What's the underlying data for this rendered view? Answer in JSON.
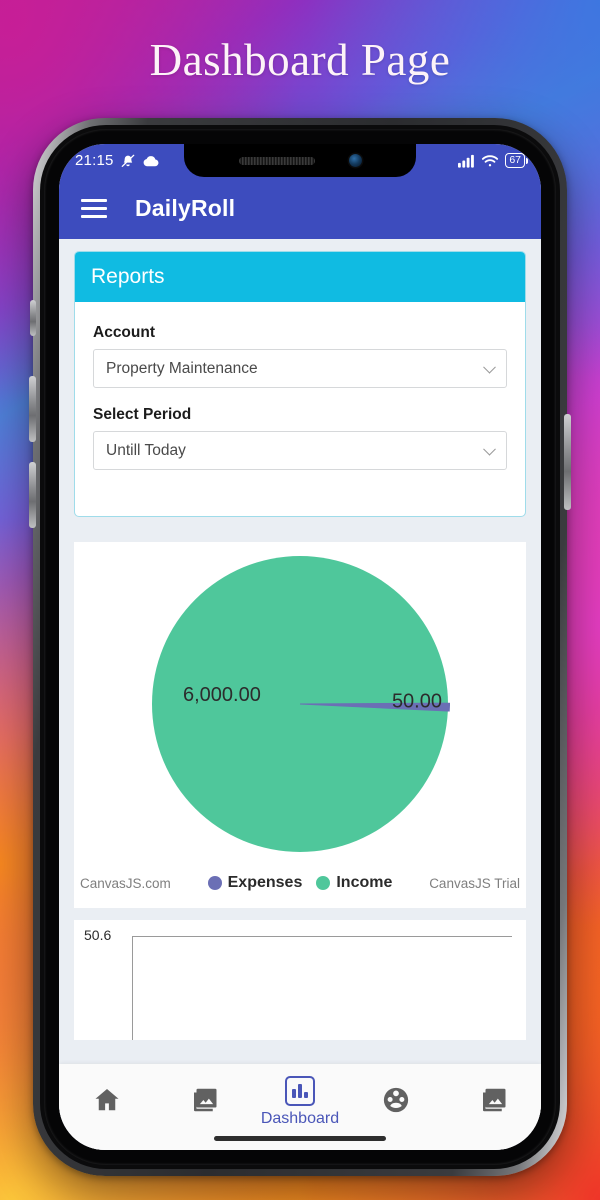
{
  "heading": "Dashboard Page",
  "status_bar": {
    "time": "21:15",
    "silent_icon": "bell-slash-icon",
    "weather_icon": "cloud-icon",
    "signal_icon": "signal-bars-icon",
    "wifi_icon": "wifi-icon",
    "battery_level": "67"
  },
  "app_bar": {
    "menu_icon": "hamburger-menu-icon",
    "title": "DailyRoll",
    "background": "#3d4cbe"
  },
  "reports_card": {
    "header": "Reports",
    "header_background": "#10bbe2",
    "account": {
      "label": "Account",
      "value": "Property Maintenance"
    },
    "period": {
      "label": "Select Period",
      "value": "Untill Today"
    }
  },
  "chart_data": {
    "type": "pie",
    "title": "",
    "categories": [
      "Expenses",
      "Income"
    ],
    "values": [
      50.0,
      6000.0
    ],
    "labels": [
      "50.00",
      "6,000.00"
    ],
    "colors": [
      "#6b6fb5",
      "#4fc79b"
    ],
    "legend": [
      "Expenses",
      "Income"
    ],
    "legend_position": "bottom",
    "watermark_left": "CanvasJS.com",
    "watermark_right": "CanvasJS Trial"
  },
  "secondary_chart": {
    "type": "bar",
    "ylabel": "",
    "y_top_tick": "50.6",
    "grid": true
  },
  "bottom_nav": {
    "items": [
      {
        "icon": "home-icon",
        "label": "",
        "active": false
      },
      {
        "icon": "photo-library-icon",
        "label": "",
        "active": false
      },
      {
        "icon": "bar-chart-icon",
        "label": "Dashboard",
        "active": true
      },
      {
        "icon": "group-people-icon",
        "label": "",
        "active": false
      },
      {
        "icon": "photo-library-icon",
        "label": "",
        "active": false
      }
    ],
    "active_color": "#4a56b8",
    "inactive_color": "#616161"
  }
}
